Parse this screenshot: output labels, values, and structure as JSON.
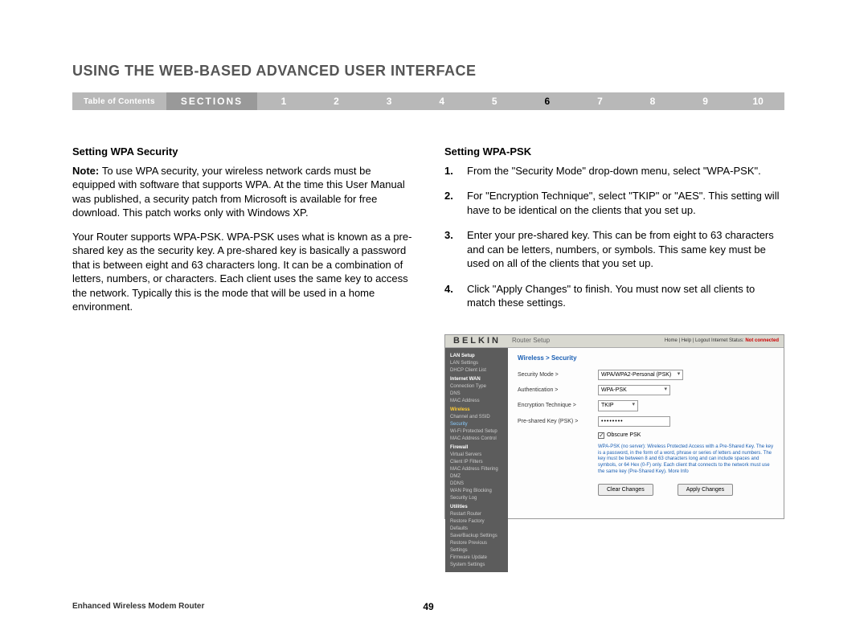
{
  "page_title": "USING THE WEB-BASED ADVANCED USER INTERFACE",
  "nav": {
    "toc": "Table of Contents",
    "sections_label": "SECTIONS",
    "numbers": [
      "1",
      "2",
      "3",
      "4",
      "5",
      "6",
      "7",
      "8",
      "9",
      "10"
    ],
    "active": "6"
  },
  "left": {
    "heading": "Setting WPA Security",
    "p1_prefix": "Note: ",
    "p1": "To use WPA security, your wireless network cards must be equipped with software that supports WPA. At the time this User Manual was published, a security patch from Microsoft is available for free download. This patch works only with Windows XP.",
    "p2": "Your Router supports WPA-PSK. WPA-PSK uses what is known as a pre-shared key as the security key. A pre-shared key is basically a password that is between eight and 63 characters long. It can be a combination of letters, numbers, or characters. Each client uses the same key to access the network. Typically this is the mode that will be used in a home environment."
  },
  "right": {
    "heading": "Setting WPA-PSK",
    "steps": [
      "From the \"Security Mode\" drop-down menu, select \"WPA-PSK\".",
      "For \"Encryption Technique\", select \"TKIP\" or \"AES\". This setting will have to be identical on the clients that you set up.",
      "Enter your pre-shared key. This can be from eight to 63 characters and can be letters, numbers, or symbols. This same key must be used on all of the clients that you set up.",
      "Click \"Apply Changes\" to finish. You must now set all clients to match these settings."
    ]
  },
  "screenshot": {
    "logo": "BELKIN",
    "router_setup": "Router Setup",
    "toplinks": "Home | Help | Logout   Internet Status: ",
    "status": "Not connected",
    "sidebar": {
      "groups": [
        {
          "hdr": "LAN Setup",
          "items": [
            "LAN Settings",
            "DHCP Client List"
          ]
        },
        {
          "hdr": "Internet WAN",
          "items": [
            "Connection Type",
            "DNS",
            "MAC Address"
          ]
        },
        {
          "hdr_active": "Wireless",
          "items": [
            "Channel and SSID"
          ],
          "active_item": "Security",
          "more": [
            "Wi-Fi Protected Setup",
            "MAC Address Control"
          ]
        },
        {
          "hdr": "Firewall",
          "items": [
            "Virtual Servers",
            "Client IP Filters",
            "MAC Address Filtering",
            "DMZ",
            "DDNS",
            "WAN Ping Blocking",
            "Security Log"
          ]
        },
        {
          "hdr": "Utilities",
          "items": [
            "Restart Router",
            "Restore Factory Defaults",
            "Save/Backup Settings",
            "Restore Previous Settings",
            "Firmware Update",
            "System Settings"
          ]
        }
      ]
    },
    "breadcrumb": "Wireless > Security",
    "rows": {
      "security_mode_label": "Security Mode >",
      "security_mode_value": "WPA/WPA2-Personal (PSK)",
      "auth_label": "Authentication >",
      "auth_value": "WPA-PSK",
      "enc_label": "Encryption Technique >",
      "enc_value": "TKIP",
      "psk_label": "Pre-shared Key (PSK) >",
      "psk_value": "••••••••",
      "obscure_label": "Obscure PSK"
    },
    "help_text": "WPA-PSK (no server): Wireless Protected Access with a Pre-Shared Key. The key is a password, in the form of a word, phrase or series of letters and numbers. The key must be between 8 and 63 characters long and can include spaces and symbols, or 64 Hex (0-F) only. Each client that connects to the network must use the same key (Pre-Shared Key). More Info",
    "buttons": {
      "clear": "Clear Changes",
      "apply": "Apply Changes"
    }
  },
  "footer": {
    "title": "Enhanced Wireless Modem Router",
    "page": "49"
  }
}
